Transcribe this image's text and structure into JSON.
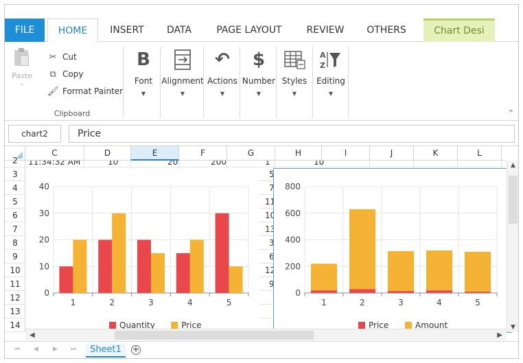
{
  "ribbon_tabs": {
    "file": "FILE",
    "home": "HOME",
    "insert": "INSERT",
    "data": "DATA",
    "page_layout": "PAGE LAYOUT",
    "review": "REVIEW",
    "others": "OTHERS",
    "chart_design": "Chart Desi"
  },
  "clipboard": {
    "paste": "Paste",
    "cut": "Cut",
    "copy": "Copy",
    "format_painter": "Format Painter",
    "group_label": "Clipboard"
  },
  "ribbon_buttons": {
    "font": "Font",
    "alignment": "Alignment",
    "actions": "Actions",
    "number": "Number",
    "styles": "Styles",
    "editing": "Editing"
  },
  "formula_bar": {
    "name_box": "chart2",
    "formula": "Price"
  },
  "columns": [
    "C",
    "D",
    "E",
    "F",
    "G",
    "H",
    "I",
    "J",
    "K",
    "L"
  ],
  "selected_column": "E",
  "rows": [
    "2",
    "3",
    "4",
    "5",
    "6",
    "7",
    "8",
    "9",
    "10",
    "11",
    "12",
    "13",
    "14"
  ],
  "row2_values": {
    "c": "11:34:32 AM",
    "d": "10",
    "e": "20",
    "f": "200",
    "g": "1",
    "h": "10"
  },
  "partial_g_values": [
    "5",
    "7",
    "11",
    "10",
    "13",
    "3",
    "6",
    "12",
    "9"
  ],
  "sheet_tab": "Sheet1",
  "chart_data": [
    {
      "type": "bar",
      "categories": [
        "1",
        "2",
        "3",
        "4",
        "5"
      ],
      "series": [
        {
          "name": "Quantity",
          "values": [
            10,
            20,
            20,
            15,
            30
          ],
          "color": "#e8474c"
        },
        {
          "name": "Price",
          "values": [
            20,
            30,
            15,
            20,
            10
          ],
          "color": "#f5b335"
        }
      ],
      "ylim": [
        0,
        40
      ],
      "yticks": [
        "0",
        "10",
        "20",
        "30",
        "40"
      ],
      "grid": true,
      "legend": "bottom"
    },
    {
      "type": "bar",
      "stacked": true,
      "categories": [
        "1",
        "2",
        "3",
        "4",
        "5"
      ],
      "series": [
        {
          "name": "Price",
          "values": [
            20,
            30,
            15,
            20,
            10
          ],
          "color": "#e8474c"
        },
        {
          "name": "Amount",
          "values": [
            200,
            600,
            300,
            300,
            300
          ],
          "color": "#f5b335"
        }
      ],
      "ylim": [
        0,
        800
      ],
      "yticks": [
        "0",
        "200",
        "400",
        "600",
        "800"
      ],
      "grid": true,
      "legend": "bottom"
    }
  ]
}
